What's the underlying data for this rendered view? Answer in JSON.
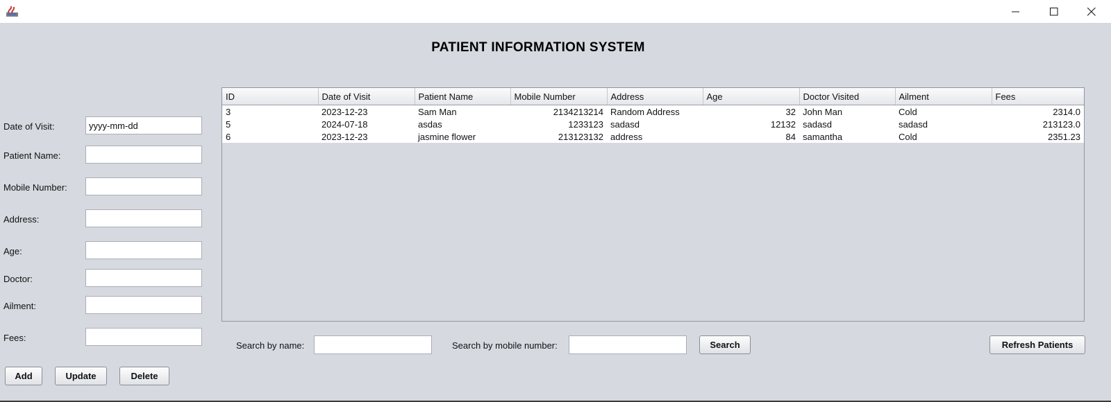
{
  "window": {
    "app_icon": "java-icon",
    "controls": [
      "minimize-icon",
      "maximize-icon",
      "close-icon"
    ]
  },
  "page_title": "PATIENT INFORMATION SYSTEM",
  "form": {
    "date_label": "Date of Visit:",
    "date_value": "yyyy-mm-dd",
    "name_label": "Patient Name:",
    "name_value": "",
    "mobile_label": "Mobile Number:",
    "mobile_value": "",
    "address_label": "Address:",
    "address_value": "",
    "age_label": "Age:",
    "age_value": "",
    "doctor_label": "Doctor:",
    "doctor_value": "",
    "ailment_label": "Ailment:",
    "ailment_value": "",
    "fees_label": "Fees:",
    "fees_value": ""
  },
  "actions": {
    "add": "Add",
    "update": "Update",
    "delete": "Delete"
  },
  "table": {
    "columns": [
      "ID",
      "Date of Visit",
      "Patient Name",
      "Mobile Number",
      "Address",
      "Age",
      "Doctor Visited",
      "Ailment",
      "Fees"
    ],
    "rows": [
      [
        "3",
        "2023-12-23",
        "Sam Man",
        "2134213214",
        "Random Address",
        "32",
        "John Man",
        "Cold",
        "2314.0"
      ],
      [
        "5",
        "2024-07-18",
        "asdas",
        "1233123",
        "sadasd",
        "12132",
        "sadasd",
        "sadasd",
        "213123.0"
      ],
      [
        "6",
        "2023-12-23",
        "jasmine flower",
        "213123132",
        "address",
        "84",
        "samantha",
        "Cold",
        "2351.23"
      ]
    ]
  },
  "search": {
    "name_label": "Search by name:",
    "name_value": "",
    "mobile_label": "Search by mobile number:",
    "mobile_value": "",
    "search_button": "Search",
    "refresh_button": "Refresh Patients"
  }
}
